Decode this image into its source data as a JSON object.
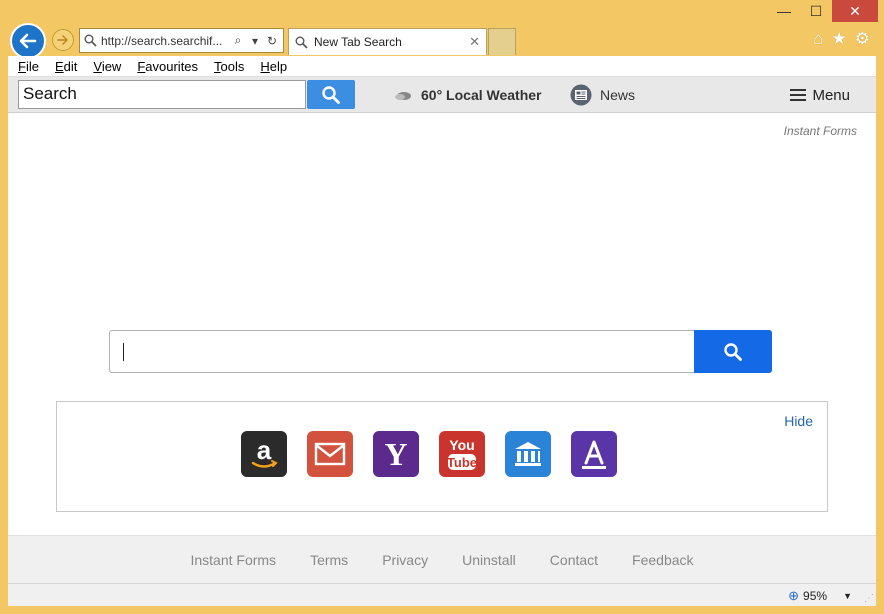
{
  "window": {
    "minimize": "—",
    "maximize": "☐",
    "close": "✕"
  },
  "address_bar": {
    "url": "http://search.searchif...",
    "search_icon": "⌕",
    "dropdown_icon": "▾",
    "refresh_icon": "↻"
  },
  "tab": {
    "title": "New Tab Search",
    "close": "✕"
  },
  "browser_icons": {
    "home": "⌂",
    "favorites": "★",
    "settings": "⚙"
  },
  "menubar": {
    "items": [
      "File",
      "Edit",
      "View",
      "Favourites",
      "Tools",
      "Help"
    ]
  },
  "toolbar": {
    "search_value": "Search",
    "weather_label": "60° Local Weather",
    "news_label": "News",
    "menu_label": "Menu"
  },
  "page": {
    "brand": "Instant Forms",
    "main_search_value": "",
    "hide_label": "Hide",
    "tiles": [
      {
        "name": "amazon",
        "color": "#2b2b2b"
      },
      {
        "name": "mail",
        "color": "#d3523e"
      },
      {
        "name": "yahoo",
        "color": "#5b2a8c",
        "glyph": "Y"
      },
      {
        "name": "youtube",
        "color": "#c9352c",
        "glyph_top": "You",
        "glyph_bottom": "Tube"
      },
      {
        "name": "bank",
        "color": "#2a83d6"
      },
      {
        "name": "app-store",
        "color": "#5a35a8",
        "glyph": "A"
      }
    ]
  },
  "footer": {
    "links": [
      "Instant Forms",
      "Terms",
      "Privacy",
      "Uninstall",
      "Contact",
      "Feedback"
    ]
  },
  "statusbar": {
    "zoom": "95%",
    "zoom_icon": "⊕",
    "zoom_arrow": "▼"
  },
  "colors": {
    "frame": "#f3c864",
    "accent_blue": "#1469e6",
    "toolbar_button": "#3c8ee3",
    "back_button": "#1e74c8"
  }
}
